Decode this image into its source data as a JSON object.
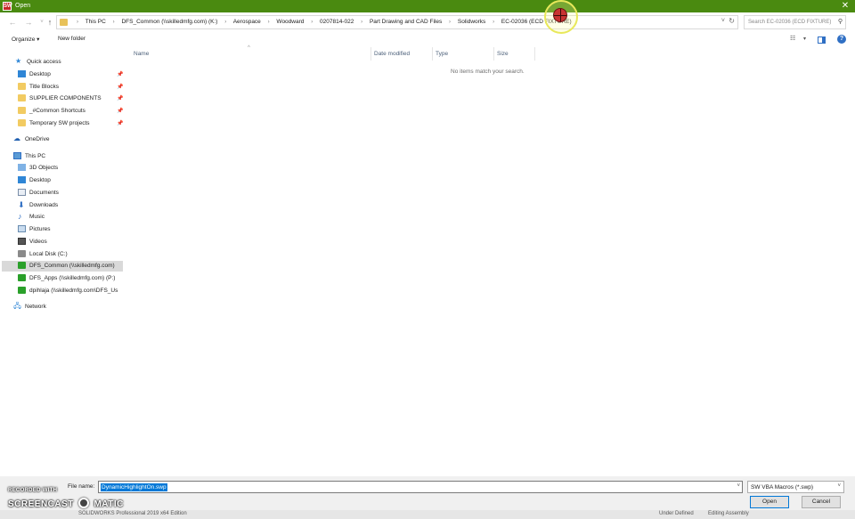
{
  "window": {
    "title": "Open",
    "app_icon": "SW",
    "close_glyph": "✕"
  },
  "nav": {
    "back_glyph": "←",
    "forward_glyph": "→",
    "recent_glyph": "˅",
    "up_glyph": "↑"
  },
  "address": {
    "crumbs": [
      "This PC",
      "DFS_Common (\\\\skilledmfg.com) (K:)",
      "Aerospace",
      "Woodward",
      "0207814-022",
      "Part Drawing and CAD Files",
      "Solidworks",
      "EC-02036 (ECD FIXTURE)"
    ],
    "separator": "›",
    "dropdown_glyph": "˅",
    "refresh_glyph": "↻"
  },
  "search": {
    "placeholder": "Search EC-02036 (ECD FIXTURE)",
    "icon": "search-icon",
    "glyph": "⚲"
  },
  "toolbar": {
    "organize": "Organize ▾",
    "new_folder": "New folder",
    "view_glyph": "☷",
    "view_dd_glyph": "▾",
    "help_glyph": "?"
  },
  "sidebar": {
    "pin_glyph": "📌",
    "items": [
      {
        "label": "Quick access",
        "icon": "star-icon"
      },
      {
        "label": "Desktop",
        "icon": "desktop-icon",
        "pinned": true
      },
      {
        "label": "Title Blocks",
        "icon": "folder-icon",
        "pinned": true
      },
      {
        "label": "SUPPLIER COMPONENTS",
        "icon": "folder-icon",
        "pinned": true
      },
      {
        "label": "_#Common Shortcuts",
        "icon": "folder-icon",
        "pinned": true
      },
      {
        "label": "Temporary SW projects",
        "icon": "folder-icon",
        "pinned": true
      },
      {
        "label": "OneDrive",
        "icon": "cloud-icon"
      },
      {
        "label": "This PC",
        "icon": "computer-icon"
      },
      {
        "label": "3D Objects",
        "icon": "3d-objects-icon"
      },
      {
        "label": "Desktop",
        "icon": "desktop-icon"
      },
      {
        "label": "Documents",
        "icon": "documents-icon"
      },
      {
        "label": "Downloads",
        "icon": "downloads-icon"
      },
      {
        "label": "Music",
        "icon": "music-icon"
      },
      {
        "label": "Pictures",
        "icon": "pictures-icon"
      },
      {
        "label": "Videos",
        "icon": "videos-icon"
      },
      {
        "label": "Local Disk (C:)",
        "icon": "disk-icon"
      },
      {
        "label": "DFS_Common (\\\\skilledmfg.com)",
        "icon": "network-drive-icon",
        "selected": true
      },
      {
        "label": "DFS_Apps (\\\\skilledmfg.com) (P:)",
        "icon": "network-drive-icon"
      },
      {
        "label": "dpihlaja (\\\\skilledmfg.com\\DFS_Us",
        "icon": "network-drive-icon"
      },
      {
        "label": "Network",
        "icon": "network-icon"
      }
    ]
  },
  "columns": {
    "name": "Name",
    "date_modified": "Date modified",
    "type": "Type",
    "size": "Size",
    "sort_glyph": "^"
  },
  "content": {
    "empty_message": "No items match your search."
  },
  "footer": {
    "file_name_label": "File name:",
    "file_name_value": "DynamicHighlightOn.swp",
    "file_type_value": "SW VBA Macros (*.swp)",
    "open_label": "Open",
    "cancel_label": "Cancel",
    "dropdown_glyph": "˅"
  },
  "underbar": {
    "left_text": "SOLIDWORKS Professional 2019 x64 Edition",
    "status_1": "Under Defined",
    "status_2": "Editing Assembly"
  },
  "watermark": {
    "line1": "RECORDED WITH",
    "line2a": "SCREENCAST",
    "line2b": "MATIC"
  }
}
